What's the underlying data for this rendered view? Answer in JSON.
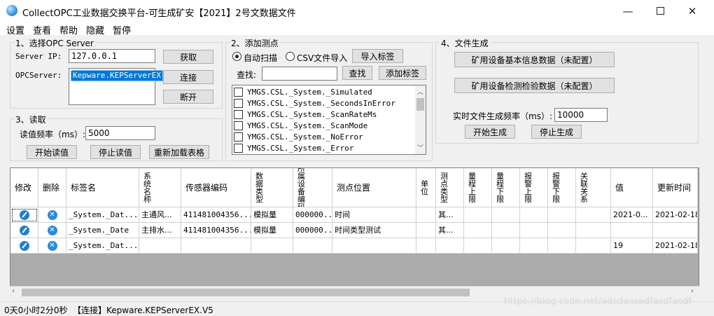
{
  "window": {
    "title": "CollectOPC工业数据交换平台-可生成矿安【2021】2号文数据文件",
    "minimize": "—",
    "close": "✕"
  },
  "menu": [
    "设置",
    "查看",
    "帮助",
    "隐藏",
    "暂停"
  ],
  "section1": {
    "label": "1、选择OPC Server",
    "server_ip_label": "Server IP:",
    "server_ip_value": "127.0.0.1",
    "opcserver_label": "OPCServer:",
    "opcserver_item": "Kepware.KEPServerEX",
    "get_btn": "获取",
    "connect_btn": "连接",
    "disconnect_btn": "断开"
  },
  "section2": {
    "label": "2、添加测点",
    "radio_auto": "自动扫描",
    "radio_csv": "CSV文件导入",
    "import_btn": "导入标签",
    "search_label": "查找:",
    "search_value": "",
    "search_btn": "查找",
    "add_tag_btn": "添加标签",
    "tags": [
      "YMGS.CSL._System._Simulated",
      "YMGS.CSL._System._SecondsInError",
      "YMGS.CSL._System._ScanRateMs",
      "YMGS.CSL._System._ScanMode",
      "YMGS.CSL._System._NoError",
      "YMGS.CSL._System._Error"
    ]
  },
  "section3": {
    "label": "3、读取",
    "freq_label": "读值频率（ms）:",
    "freq_value": "5000",
    "start_btn": "开始读值",
    "stop_btn": "停止读值",
    "reload_btn": "重新加载表格"
  },
  "section4": {
    "label": "4、文件生成",
    "basic_btn": "矿用设备基本信息数据（未配置）",
    "inspect_btn": "矿用设备检测检验数据（未配置）",
    "freq_label": "实时文件生成频率（ms）:",
    "freq_value": "10000",
    "start_btn": "开始生成",
    "stop_btn": "停止生成"
  },
  "grid": {
    "headers": [
      "修改",
      "删除",
      "标签名",
      "系统名称",
      "传感器编码",
      "数据类型",
      "所属设备编码",
      "测点位置",
      "单位",
      "测点类型",
      "量程上限",
      "量程下限",
      "报警上限",
      "报警下限",
      "关联关系",
      "值",
      "更新时间"
    ],
    "rows": [
      [
        "",
        "",
        "_System._Dat...",
        "主通风...",
        "411481004356...",
        "模拟量",
        "000000...",
        "时间",
        "",
        "其...",
        "",
        "",
        "",
        "",
        "",
        "2021-0...",
        "2021-02-18"
      ],
      [
        "",
        "",
        "_System._Date",
        "主排水...",
        "411481004356...",
        "模拟量",
        "000000...",
        "时间类型测试",
        "",
        "其...",
        "",
        "",
        "",
        "",
        "",
        "",
        ""
      ],
      [
        "",
        "",
        "_System._Dat...",
        "",
        "",
        "",
        "",
        "",
        "",
        "",
        "",
        "",
        "",
        "",
        "",
        "19",
        "2021-02-18"
      ]
    ]
  },
  "status": {
    "uptime": "0天0小时2分0秒",
    "connection": "【连接】Kepware.KEPServerEX.V5",
    "watermark": "https://blog.csdn.net/adsdassadfasdfasdf"
  }
}
